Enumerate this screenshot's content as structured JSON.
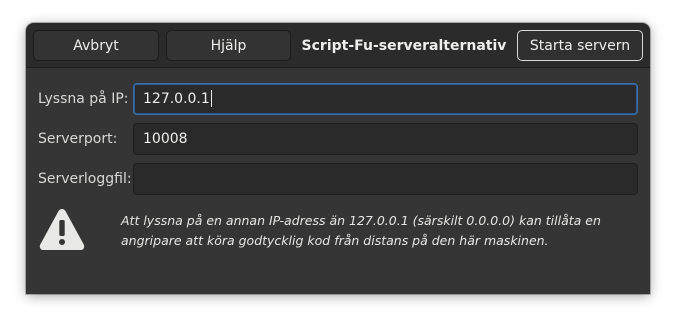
{
  "header": {
    "cancel_label": "Avbryt",
    "help_label": "Hjälp",
    "title": "Script-Fu-serveralternativ",
    "start_label": "Starta servern"
  },
  "form": {
    "ip_label": "Lyssna på IP:",
    "ip_value": "127.0.0.1",
    "port_label": "Serverport:",
    "port_value": "10008",
    "logfile_label": "Serverloggfil:",
    "logfile_value": ""
  },
  "warning": {
    "icon": "warning-triangle-icon",
    "text": "Att lyssna på en annan IP-adress än 127.0.0.1 (särskilt 0.0.0.0) kan tillåta en angripare att köra godtycklig kod från distans på den här maskinen."
  },
  "colors": {
    "window_bg": "#353535",
    "headerbar_bg": "#2b2b2b",
    "entry_bg": "#2a2a2a",
    "focus_border": "#3b6ea5",
    "text": "#eeeeec"
  }
}
